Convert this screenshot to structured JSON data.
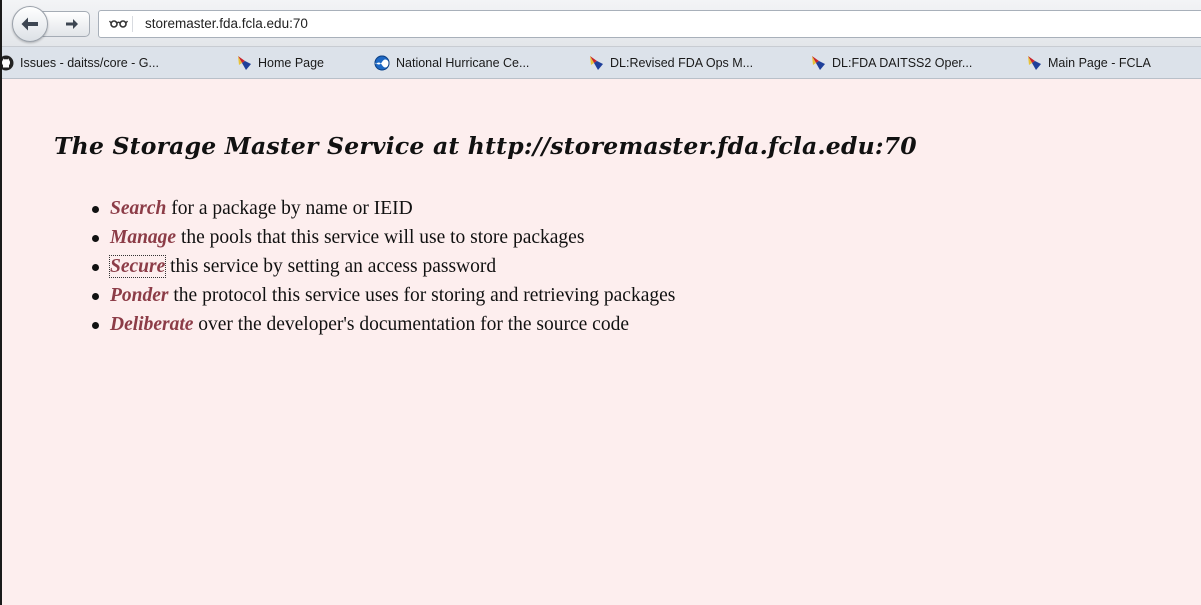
{
  "browser": {
    "url": "storemaster.fda.fcla.edu:70",
    "bookmarks": [
      {
        "label": "Issues - daitss/core - G...",
        "icon": "github-icon"
      },
      {
        "label": "Home Page",
        "icon": "fcla-icon"
      },
      {
        "label": "National Hurricane Ce...",
        "icon": "noaa-icon"
      },
      {
        "label": "DL:Revised FDA Ops M...",
        "icon": "fcla-icon"
      },
      {
        "label": "DL:FDA DAITSS2 Oper...",
        "icon": "fcla-icon"
      },
      {
        "label": "Main Page - FCLA",
        "icon": "fcla-icon"
      }
    ]
  },
  "page": {
    "title": "The Storage Master Service at http://storemaster.fda.fcla.edu:70",
    "link_color": "#8c3c47",
    "background": "#fdeeee",
    "items": [
      {
        "link": "Search",
        "text": " for a package by name or IEID"
      },
      {
        "link": "Manage",
        "text": " the pools that this service will use to store packages"
      },
      {
        "link": "Secure",
        "text": " this service by setting an access password"
      },
      {
        "link": "Ponder",
        "text": " the protocol this service uses for storing and retrieving packages"
      },
      {
        "link": "Deliberate",
        "text": " over the developer's documentation for the source code"
      }
    ]
  }
}
